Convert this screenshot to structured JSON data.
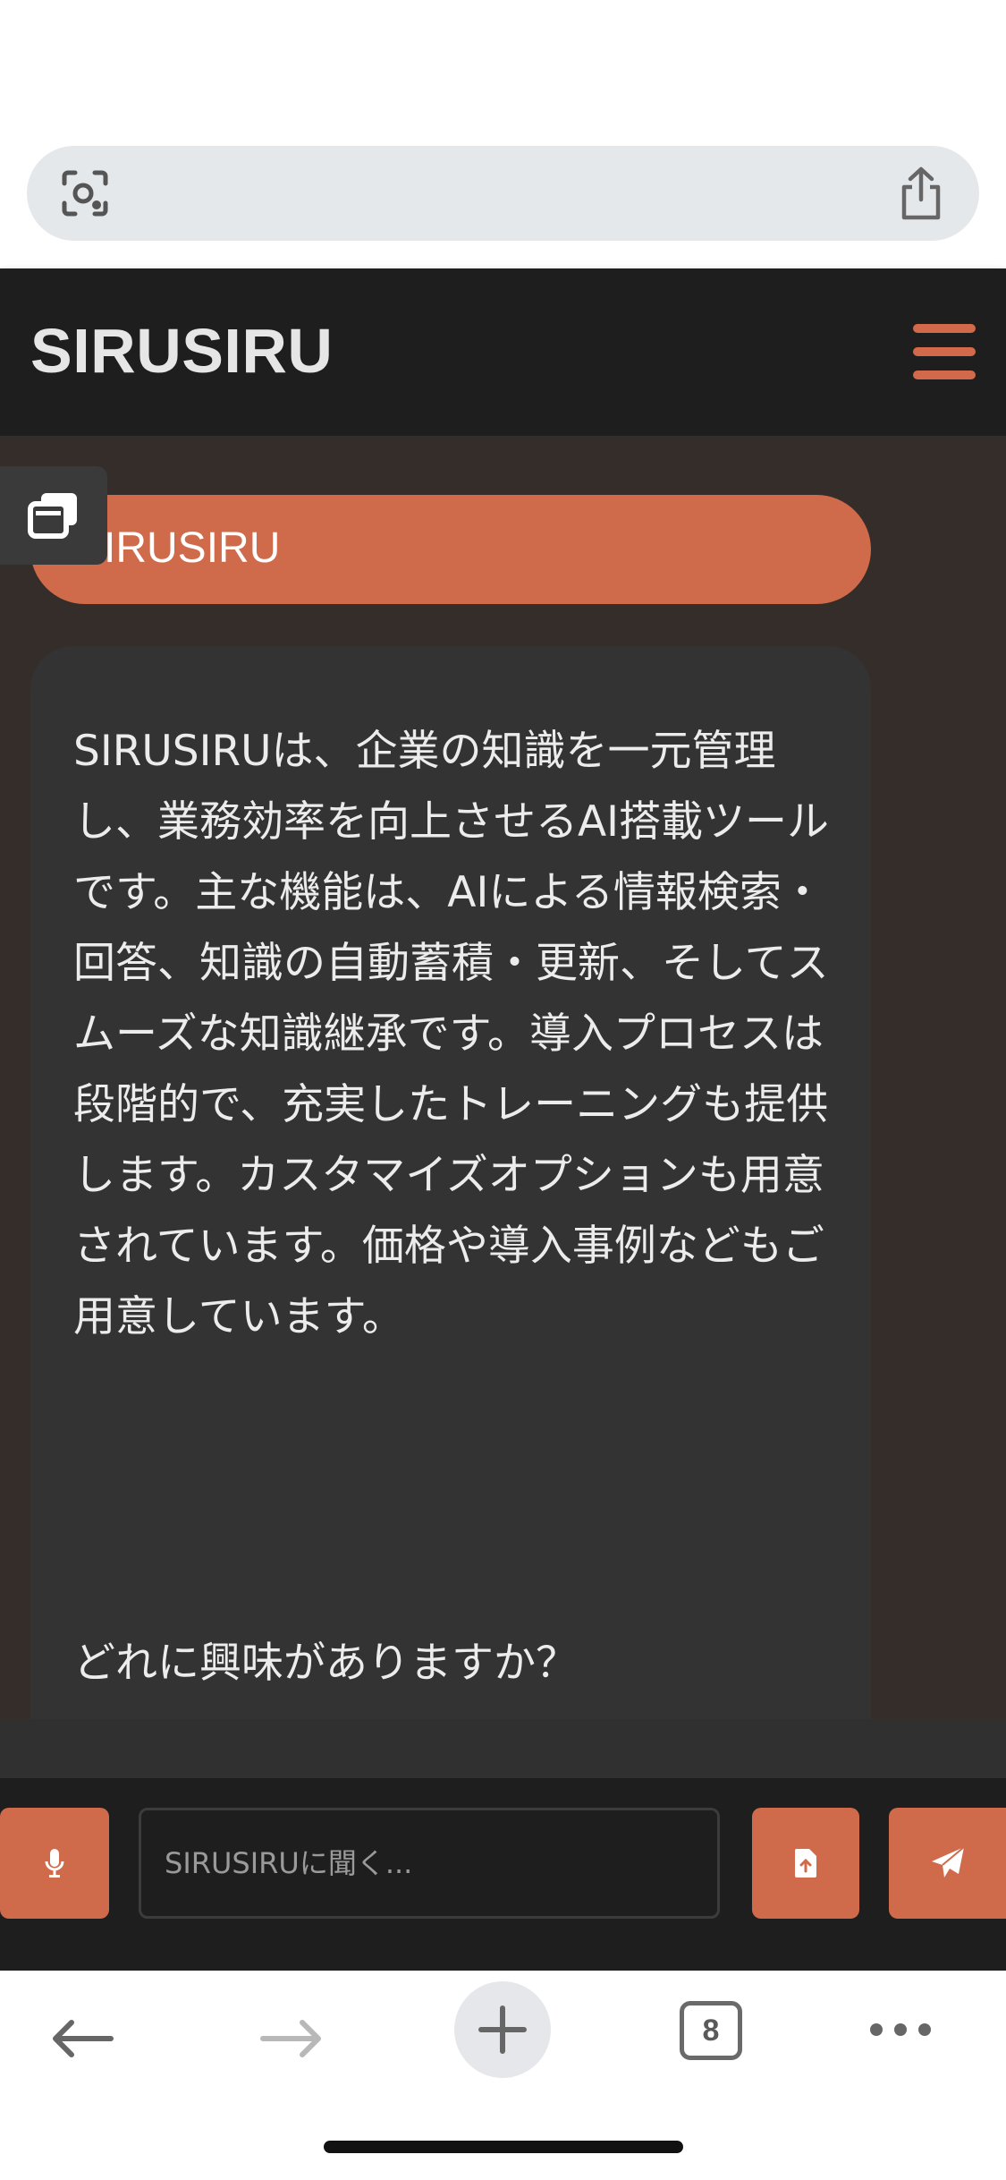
{
  "browser": {
    "lens_icon": "camera-search-icon",
    "share_icon": "share-icon",
    "tab_count": "8"
  },
  "header": {
    "title": "SIRUSIRU"
  },
  "chat": {
    "user_message": "SIRUSIRU",
    "bot_message": "SIRUSIRUは、企業の知識を一元管理し、業務効率を向上させるAI搭載ツールです。主な機能は、AIによる情報検索・回答、知識の自動蓄積・更新、そしてスムーズな知識継承です。導入プロセスは段階的で、充実したトレーニングも提供します。カスタマイズオプションも用意されています。価格や導入事例などもご用意しています。",
    "bot_question": "どれに興味がありますか？"
  },
  "input": {
    "placeholder": "SIRUSIRUに聞く..."
  },
  "colors": {
    "accent": "#cf6a4a",
    "header_bg": "#1e1e1e",
    "chat_bg": "#352d29",
    "bubble_bg": "#333333"
  }
}
